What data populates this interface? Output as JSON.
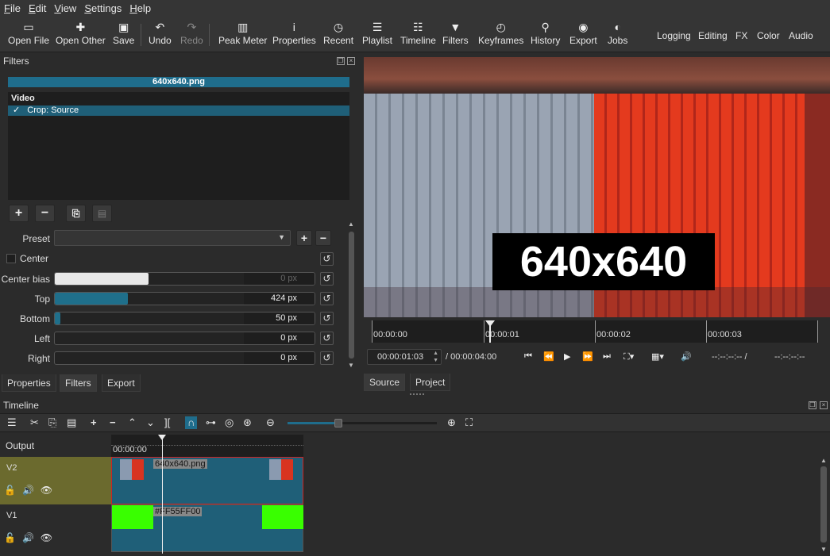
{
  "menu": [
    "File",
    "Edit",
    "View",
    "Settings",
    "Help"
  ],
  "toolbar": {
    "open_file": "Open File",
    "open_other": "Open Other",
    "save": "Save",
    "undo": "Undo",
    "redo": "Redo",
    "peak_meter": "Peak Meter",
    "properties": "Properties",
    "recent": "Recent",
    "playlist": "Playlist",
    "timeline": "Timeline",
    "filters": "Filters",
    "keyframes": "Keyframes",
    "history": "History",
    "export": "Export",
    "jobs": "Jobs"
  },
  "workspaces": [
    "Logging",
    "Editing",
    "FX",
    "Color",
    "Audio"
  ],
  "filters_panel": {
    "title": "Filters",
    "clip_name": "640x640.png",
    "section": "Video",
    "item_check": "✓",
    "item": "Crop: Source",
    "preset_label": "Preset",
    "center_label": "Center",
    "params": [
      {
        "label": "Center bias",
        "value": "0 px",
        "fill": 0.36,
        "fill_color": "#e8e8e8"
      },
      {
        "label": "Top",
        "value": "424 px",
        "fill": 0.28,
        "fill_color": "#1f6f8b"
      },
      {
        "label": "Bottom",
        "value": "50 px",
        "fill": 0.02,
        "fill_color": "#1f6f8b"
      },
      {
        "label": "Left",
        "value": "0 px",
        "fill": 0,
        "fill_color": "#1f6f8b"
      },
      {
        "label": "Right",
        "value": "0 px",
        "fill": 0,
        "fill_color": "#1f6f8b"
      }
    ]
  },
  "left_tabs": [
    "Properties",
    "Filters",
    "Export"
  ],
  "player": {
    "image_text": "640x640",
    "ruler": [
      "00:00:00",
      "00:00:01",
      "00:00:02",
      "00:00:03"
    ],
    "position": "00:00:01:03",
    "duration": "/ 00:00:04:00",
    "in_point": "--:--:--:-- /",
    "out_point": "--:--:--:--",
    "tabs": [
      "Source",
      "Project"
    ]
  },
  "timeline": {
    "title": "Timeline",
    "output_label": "Output",
    "time": "00:00:00",
    "tracks": [
      {
        "name": "V2",
        "clip": "640x640.png"
      },
      {
        "name": "V1",
        "clip": "#FF55FF00"
      }
    ]
  },
  "colors": {
    "accent": "#1f6d8c",
    "v2_head": "#6b6a2e",
    "green": "#39ff00",
    "clip_border": "#d02424"
  }
}
